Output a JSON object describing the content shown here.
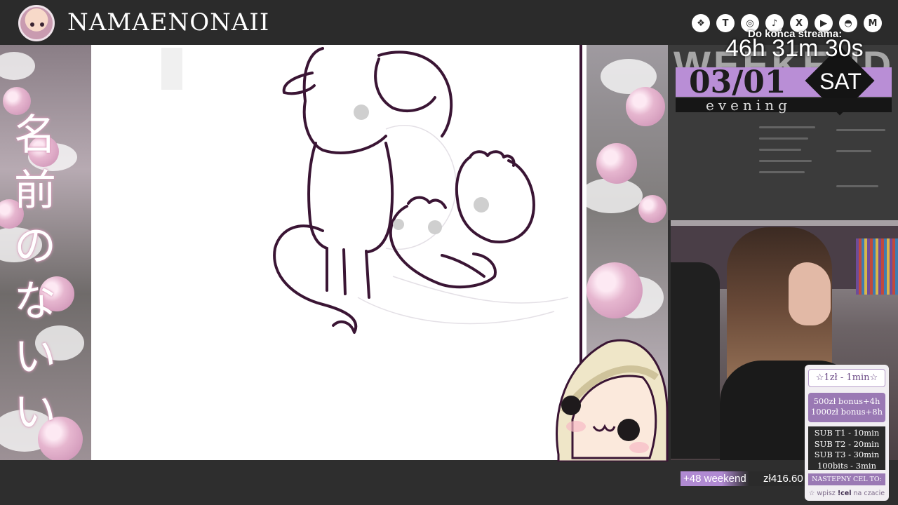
{
  "header": {
    "channel_name": "NAMAENONAII",
    "socials": [
      {
        "icon": "linktree-icon",
        "glyph": "❖"
      },
      {
        "icon": "twitch-icon",
        "glyph": "T"
      },
      {
        "icon": "instagram-icon",
        "glyph": "◎"
      },
      {
        "icon": "tiktok-icon",
        "glyph": "♪"
      },
      {
        "icon": "x-icon",
        "glyph": "X"
      },
      {
        "icon": "youtube-icon",
        "glyph": "▶"
      },
      {
        "icon": "discord-icon",
        "glyph": "◓"
      },
      {
        "icon": "mail-icon",
        "glyph": "M"
      }
    ]
  },
  "left_panel": {
    "vertical_title": "名前のないい"
  },
  "schedule": {
    "weekend_label": "WEEKEND",
    "date": "03/01",
    "day": "SAT",
    "time_of_day": "evening"
  },
  "countdown": {
    "label": "Do końca streama:",
    "time": "46h 31m 30s"
  },
  "donation": {
    "rate": "☆1zł - 1min☆",
    "bonus_1": "500zł bonus+4h",
    "bonus_2": "1000zł bonus+8h",
    "sub_rates": [
      "SUB T1 - 10min",
      "SUB T2 - 20min",
      "SUB T3 - 30min",
      "100bits - 3min"
    ],
    "next_goal_label": "NASTEPNY CEL TO:",
    "input_hint_prefix": "☆ wpisz ",
    "input_hint_command": "!cel",
    "input_hint_suffix": " na czacie"
  },
  "ticker": {
    "tag": "+48 weekend",
    "amount": "zł416.60"
  },
  "colors": {
    "accent": "#b98ed6",
    "header_bg": "#2b2b2b",
    "lineart": "#3a1534"
  }
}
